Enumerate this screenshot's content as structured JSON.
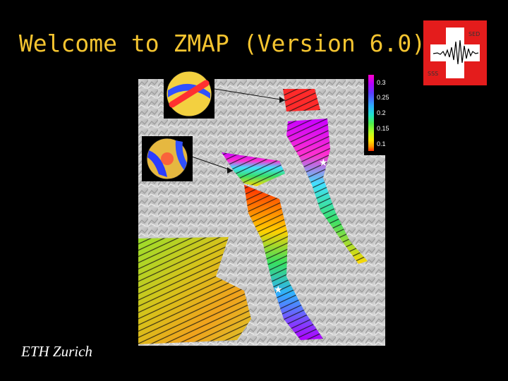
{
  "title": "Welcome to ZMAP (Version 6.0)",
  "footer": "ETH Zurich",
  "logo": {
    "top_label": "SED",
    "bottom_label": "SSS"
  },
  "colorbar": {
    "ticks": [
      "0.3",
      "0.25",
      "0.2",
      "0.15",
      "0.1"
    ]
  },
  "colors": {
    "title": "#f4c430",
    "logo_red": "#e41c1c",
    "background": "#000000"
  }
}
